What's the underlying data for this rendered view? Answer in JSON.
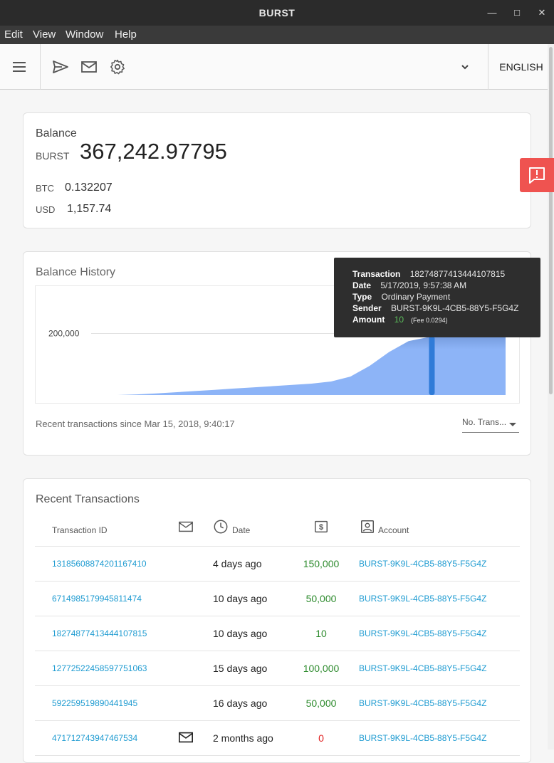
{
  "window": {
    "title": "BURST",
    "min_icon": "minimize-icon",
    "max_icon": "maximize-icon",
    "close_icon": "close-icon"
  },
  "menu": [
    "Edit",
    "View",
    "Window",
    "Help"
  ],
  "toolbar": {
    "language": "ENGLISH"
  },
  "balance": {
    "title": "Balance",
    "unit": "BURST",
    "amount": "367,242.97795",
    "btc_label": "BTC",
    "btc_value": "0.132207",
    "usd_label": "USD",
    "usd_value": "1,157.74"
  },
  "history": {
    "title": "Balance History",
    "since": "Recent transactions since Mar 15, 2018, 9:40:17",
    "select_value": "No. Trans...",
    "tooltip": {
      "transaction_label": "Transaction",
      "transaction_value": "18274877413444107815",
      "date_label": "Date",
      "date_value": "5/17/2019, 9:57:38 AM",
      "type_label": "Type",
      "type_value": "Ordinary Payment",
      "sender_label": "Sender",
      "sender_value": "BURST-9K9L-4CB5-88Y5-F5G4Z",
      "amount_label": "Amount",
      "amount_value": "10",
      "fee": "(Fee 0.0294)"
    }
  },
  "chart_data": {
    "type": "area",
    "title": "",
    "ytick_labels": [
      "200,000"
    ],
    "ylim": [
      0,
      340000
    ],
    "x": [
      0,
      5,
      10,
      15,
      20,
      25,
      30,
      35,
      40,
      45,
      50,
      55,
      60,
      65,
      70,
      75,
      80,
      85,
      90,
      95,
      100
    ],
    "series": [
      {
        "values": [
          0,
          2000,
          5000,
          9000,
          13000,
          17000,
          21000,
          25000,
          29000,
          33000,
          37000,
          44000,
          60000,
          95000,
          140000,
          175000,
          188000,
          200000,
          240000,
          290000,
          330000
        ]
      }
    ],
    "highlight_x": 81,
    "colors": {
      "fill_top": "#2c4d8c",
      "fill_bottom": "#8db4f7",
      "highlight": "#2f7bd8"
    }
  },
  "transactions": {
    "title": "Recent Transactions",
    "headers": {
      "id": "Transaction ID",
      "date": "Date",
      "account": "Account"
    },
    "header_icons": {
      "message": "envelope-icon",
      "date": "clock-icon",
      "amount": "dollar-icon",
      "account": "account-icon"
    },
    "rows": [
      {
        "id": "13185608874201167410",
        "date": "4 days ago",
        "amount": "150,000",
        "account": "BURST-9K9L-4CB5-88Y5-F5G4Z",
        "msg": false,
        "color": "#2e8b2e"
      },
      {
        "id": "6714985179945811474",
        "date": "10 days ago",
        "amount": "50,000",
        "account": "BURST-9K9L-4CB5-88Y5-F5G4Z",
        "msg": false,
        "color": "#2e8b2e"
      },
      {
        "id": "18274877413444107815",
        "date": "10 days ago",
        "amount": "10",
        "account": "BURST-9K9L-4CB5-88Y5-F5G4Z",
        "msg": false,
        "color": "#2e8b2e"
      },
      {
        "id": "12772522458597751063",
        "date": "15 days ago",
        "amount": "100,000",
        "account": "BURST-9K9L-4CB5-88Y5-F5G4Z",
        "msg": false,
        "color": "#2e8b2e"
      },
      {
        "id": "592259519890441945",
        "date": "16 days ago",
        "amount": "50,000",
        "account": "BURST-9K9L-4CB5-88Y5-F5G4Z",
        "msg": false,
        "color": "#2e8b2e"
      },
      {
        "id": "471712743947467534",
        "date": "2 months ago",
        "amount": "0",
        "account": "BURST-9K9L-4CB5-88Y5-F5G4Z",
        "msg": true,
        "color": "#e02020"
      }
    ]
  },
  "colors": {
    "link": "#1e9bd1",
    "positive": "#2e8b2e",
    "zero": "#e02020",
    "report": "#ef5350"
  }
}
